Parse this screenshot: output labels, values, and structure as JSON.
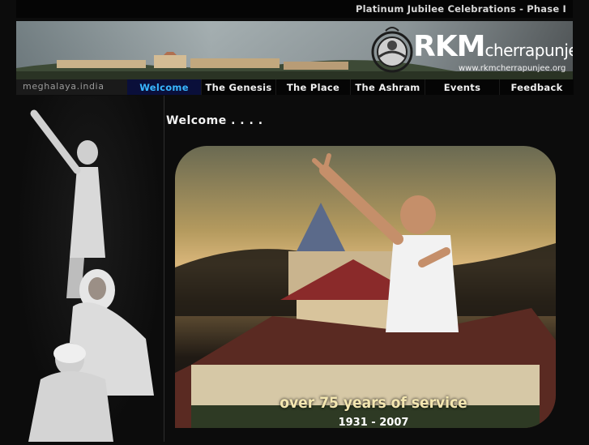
{
  "topbar": {
    "title": "Platinum Jubilee Celebrations - Phase I"
  },
  "banner": {
    "logo_big": "RKM",
    "logo_small": "cherrapunjee",
    "url": "www.rkmcherrapunjee.org",
    "emblem_icon": "ramakrishna-mission-emblem-icon"
  },
  "nav": {
    "region": "meghalaya.india",
    "tabs": [
      {
        "label": "Welcome",
        "active": true
      },
      {
        "label": "The Genesis"
      },
      {
        "label": "The Place"
      },
      {
        "label": "The Ashram"
      },
      {
        "label": "Events"
      },
      {
        "label": "Feedback"
      }
    ]
  },
  "main": {
    "heading": "Welcome . . . .",
    "hero": {
      "caption_line1": "over 75 years of service",
      "caption_line2": "1931 - 2007"
    }
  },
  "colors": {
    "background": "#0c0c0c",
    "active_tab_bg": "#0a0f3a",
    "active_tab_text": "#38b6ff",
    "caption_gold": "#f3e6b0"
  }
}
